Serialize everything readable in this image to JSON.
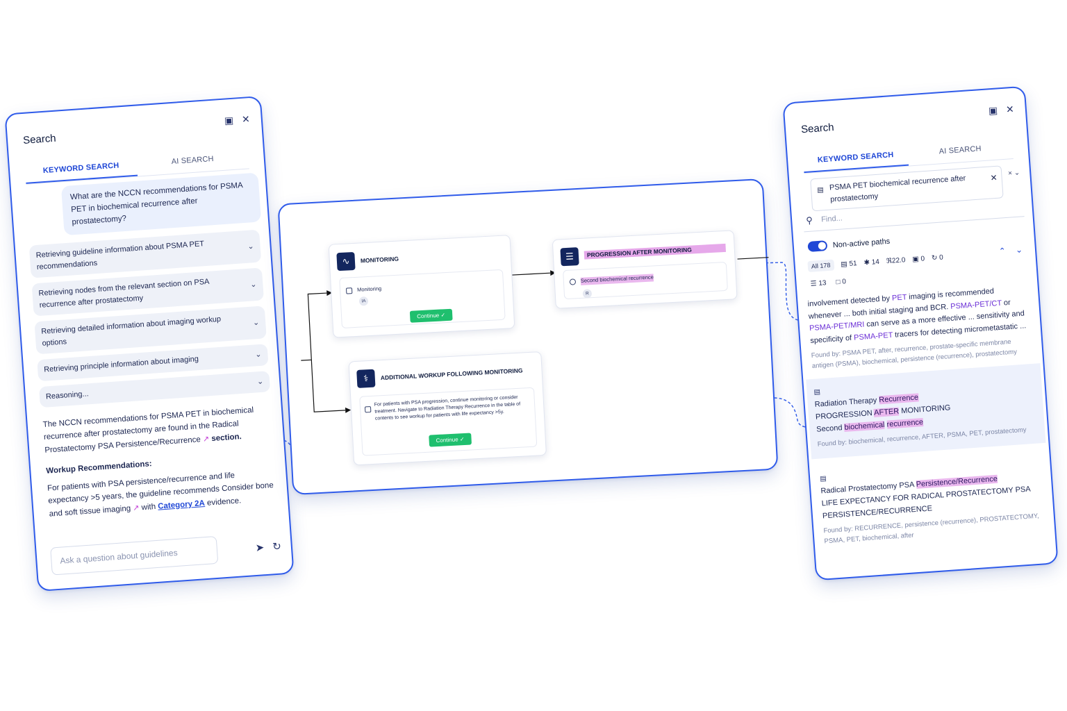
{
  "left": {
    "title": "Search",
    "tabs": [
      "KEYWORD SEARCH",
      "AI SEARCH"
    ],
    "question": "What are the NCCN recommendations for PSMA PET in biochemical recurrence after prostatectomy?",
    "steps": [
      "Retrieving guideline information about PSMA PET recommendations",
      "Retrieving nodes from the relevant section on PSA recurrence after prostatectomy",
      "Retrieving detailed information about imaging workup options",
      "Retrieving principle information about imaging",
      "Reasoning..."
    ],
    "answer_intro": "The NCCN recommendations for PSMA PET in biochemical recurrence after prostatectomy are found in the Radical Prostatectomy PSA Persistence/Recurrence",
    "answer_section": "section.",
    "workup_heading": "Workup Recommendations:",
    "workup_text_1": "For patients with PSA persistence/recurrence and life expectancy >5 years, the guideline recommends Consider bone and soft tissue imaging",
    "workup_with": "with",
    "category_link": "Category 2A",
    "workup_end": "evidence.",
    "ask_placeholder": "Ask a question about guidelines"
  },
  "canvas": {
    "node_monitoring": {
      "title": "MONITORING",
      "option": "Monitoring",
      "badge": "IA",
      "continue": "Continue"
    },
    "node_progression": {
      "title": "PROGRESSION AFTER MONITORING",
      "option": "Second biochemical recurrence",
      "badge": "R"
    },
    "node_additional": {
      "title": "ADDITIONAL WORKUP FOLLOWING MONITORING",
      "option": "For patients with PSA progression, continue monitoring or consider treatment. Navigate to Radiation Therapy Recurrence in the table of contents to see workup for patients with life expectancy >5y.",
      "continue": "Continue"
    }
  },
  "right": {
    "title": "Search",
    "tabs": [
      "KEYWORD SEARCH",
      "AI SEARCH"
    ],
    "chip": "PSMA PET biochemical recurrence after prostatectomy",
    "find_placeholder": "Find...",
    "toggle_label": "Non-active paths",
    "stats": {
      "all": "All 178",
      "s1": "51",
      "s2": "14",
      "s3": "22.0",
      "s4": "0",
      "s5": "0",
      "s6": "13",
      "s7": "0"
    },
    "snippet": {
      "t1": "involvement detected by",
      "k1": "PET",
      "t2": "imaging is recommended whenever ... both initial staging and BCR.",
      "k2": "PSMA-PET/CT",
      "t3": "or",
      "k3": "PSMA-PET/MRI",
      "t4": "can serve as a more effective ... sensitivity and specificity of",
      "k4": "PSMA-PET",
      "t5": "tracers for detecting micrometastatic ...",
      "found": "Found by: PSMA PET, after, recurrence, prostate-specific membrane antigen (PSMA), biochemical, persistence (recurrence), prostatectomy"
    },
    "result1": {
      "line1a": "Radiation Therapy",
      "line1b": "Recurrence",
      "line2a": "PROGRESSION",
      "line2b": "AFTER",
      "line2c": "MONITORING",
      "line3a": "Second",
      "line3b": "biochemical",
      "line3c": "recurrence",
      "found": "Found by: biochemical, recurrence, AFTER, PSMA, PET, prostatectomy"
    },
    "result2": {
      "line1a": "Radical Prostatectomy",
      "line1b": "PSA",
      "line1c": "Persistence/Recurrence",
      "line2": "LIFE EXPECTANCY FOR RADICAL PROSTATECTOMY PSA PERSISTENCE/RECURRENCE",
      "found": "Found by: RECURRENCE, persistence (recurrence), PROSTATECTOMY, PSMA, PET, biochemical, after"
    }
  }
}
